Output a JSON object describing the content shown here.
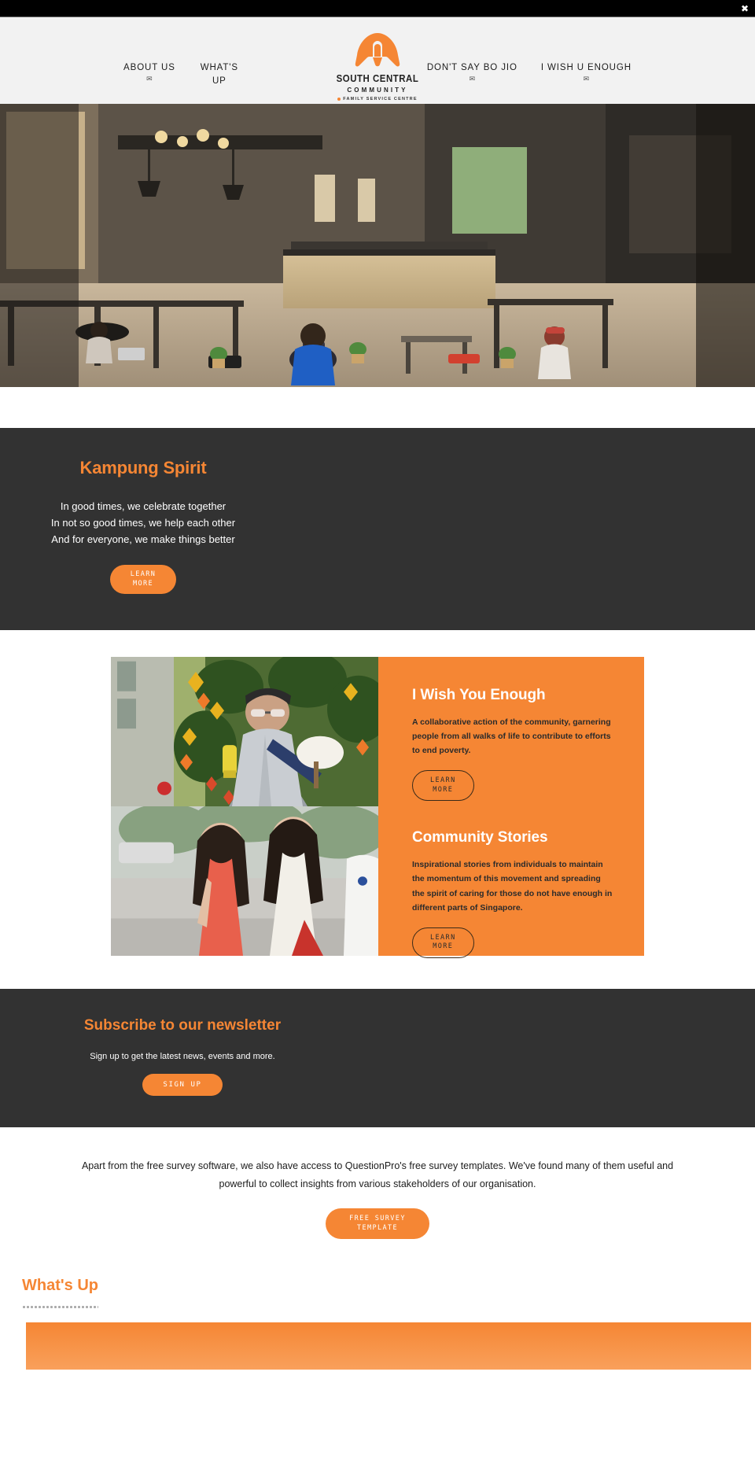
{
  "topbar": {
    "close_label": "✖"
  },
  "nav": {
    "left": [
      {
        "label": "ABOUT US",
        "icon": "mail-icon",
        "icon_glyph": "✉"
      },
      {
        "label": "WHAT'S\nUP",
        "icon": "mail-icon",
        "icon_glyph": ""
      }
    ],
    "right": [
      {
        "label": "DON'T SAY BO JIO",
        "icon": "mail-icon",
        "icon_glyph": "✉"
      },
      {
        "label": "I WISH U ENOUGH",
        "icon": "mail-icon",
        "icon_glyph": "✉"
      }
    ]
  },
  "logo": {
    "name": "SOUTH CENTRAL",
    "sub": "COMMUNITY",
    "tagline": "FAMILY SERVICE CENTRE",
    "mark": "house-arch-logo-icon",
    "color": "#f58634"
  },
  "hero": {
    "alt": "community-cafe-photo"
  },
  "kampung": {
    "title": "Kampung Spirit",
    "lines": "In good times, we celebrate together\nIn not so good times, we help each other\nAnd for everyone, we make things better",
    "button": "LEARN\nMORE"
  },
  "programmes": [
    {
      "title": "I Wish You Enough",
      "text": "A collaborative action of the community, garnering people from all walks of life to contribute to efforts to end poverty.",
      "button": "LEARN\nMORE"
    },
    {
      "title": "Community Stories",
      "text": "Inspirational stories from individuals to maintain the momentum of this movement and spreading the spirit of caring for those do not have enough in different parts of Singapore.",
      "button": "LEARN\nMORE"
    }
  ],
  "newsletter": {
    "title": "Subscribe to our newsletter",
    "subtitle": "Sign up to get the latest news, events and more.",
    "button": "SIGN UP"
  },
  "testimonial": {
    "text": "Apart from the free survey software, we also have access to QuestionPro's free survey templates. We've found many of them useful and powerful to collect insights from various stakeholders of our organisation.",
    "button": "FREE SURVEY\nTEMPLATE"
  },
  "whatsup": {
    "title": "What's Up"
  },
  "colors": {
    "accent": "#f58634",
    "dark": "#323232",
    "header_bg": "#f2f2f2"
  }
}
